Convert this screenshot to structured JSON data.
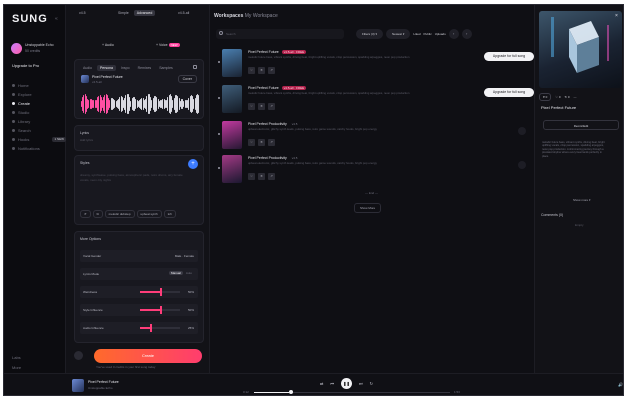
{
  "sidebar": {
    "logo": "SUNG",
    "user": {
      "name": "Unstoppable Echo",
      "credits": "50 credits"
    },
    "upgrade": "Upgrade to Pro",
    "items": [
      {
        "label": "Home",
        "active": false
      },
      {
        "label": "Explore",
        "active": false
      },
      {
        "label": "Create",
        "active": true
      },
      {
        "label": "Studio",
        "active": false
      },
      {
        "label": "Library",
        "active": false
      },
      {
        "label": "Search",
        "active": false
      },
      {
        "label": "Hooks",
        "active": false,
        "badge": "1 NEW"
      },
      {
        "label": "Notifications",
        "active": false
      }
    ],
    "bottom": [
      "Labs",
      "More"
    ]
  },
  "create": {
    "version": "v4.5",
    "mode": {
      "simple": "Simple",
      "advanced": "Advanced"
    },
    "model": "v4.5-all",
    "add_audio": "+ Audio",
    "add_voice": "+ Voice",
    "voice_badge": "NEW",
    "audio_tabs": [
      "Audio",
      "Persona",
      "Inspo",
      "Remixes",
      "Samples"
    ],
    "clip": {
      "title": "Pixel Perfect Future",
      "sub": "v4.5-all",
      "cover_btn": "Cover"
    },
    "lyrics": {
      "label": "Lyrics",
      "placeholder": "Add lyrics"
    },
    "styles": {
      "label": "Styles",
      "placeholder": "dreamy, synthwave, pulsing bass, atmospheric pads, retro drums, airy female vocals, neon city nights",
      "tags": [
        "↺",
        "⧉",
        "melodic dubstep",
        "upbeat synth",
        "lofi"
      ]
    },
    "more_options": {
      "title": "More Options",
      "rows": [
        {
          "label": "Vocal Gender",
          "value": "Male · Female"
        },
        {
          "label": "Lyrics Mode",
          "toggle": [
            "Manual",
            "Auto"
          ]
        },
        {
          "label": "Weirdness",
          "value": "50%",
          "level": 0.5
        },
        {
          "label": "Style Influence",
          "value": "50%",
          "level": 0.5
        },
        {
          "label": "Audio Influence",
          "value": "25%",
          "level": 0.25
        }
      ]
    },
    "create_button": "Create",
    "hint": "You've used 0 credits in your first song today"
  },
  "workspace": {
    "title": "Workspaces",
    "crumb": "My Workspace",
    "search_placeholder": "Search",
    "filters": [
      "Filters (3) ▾",
      "Newest ▾"
    ],
    "filter_links": [
      "Liked",
      "Public",
      "Uploads"
    ],
    "songs": [
      {
        "title": "Pixel Perfect Future",
        "tag": "v4.5-all · FREE",
        "ver": "",
        "desc": "melodic future bass, vibrant synths, driving beat, bright uplifting vocals, crisp percussion, sparkling arpeggios, neon pop production",
        "upgrade": "Upgrade for full song",
        "colors": [
          "#4a7fb0",
          "#1a2332"
        ]
      },
      {
        "title": "Pixel Perfect Future",
        "tag": "v4.5-all · FREE",
        "ver": "",
        "desc": "melodic future bass, vibrant synths, driving beat, bright uplifting vocals, crisp percussion, sparkling arpeggios, neon pop production",
        "upgrade": "Upgrade for full song",
        "colors": [
          "#3f5e7a",
          "#141a24"
        ]
      },
      {
        "title": "Pixel Perfect Productivity",
        "tag": "",
        "ver": "v4.5",
        "desc": "upbeat electronic, glitchy synth leads, pulsing bass, retro game sounds, catchy hooks, bright pop energy",
        "upgrade": "",
        "colors": [
          "#c23aa0",
          "#261833"
        ]
      },
      {
        "title": "Pixel Perfect Productivity",
        "tag": "",
        "ver": "v4.5",
        "desc": "upbeat electronic, glitchy synth leads, pulsing bass, retro game sounds, catchy hooks, bright pop energy",
        "upgrade": "",
        "colors": [
          "#a43a86",
          "#1b1830"
        ]
      }
    ],
    "end_text": "— End —",
    "show_more": "Show More"
  },
  "details": {
    "likes": "♥ 0",
    "stats": [
      "♡ 0",
      "↻ 0",
      "⋯"
    ],
    "title": "Pixel Perfect Future",
    "remix_btn": "Remix/Edit",
    "description": "melodic future bass, vibrant synths, driving beat, bright uplifting vocals, crisp percussion, sparkling arpeggios, neon pop production. A shimmering journey through a pixelated skyline where every beat lands perfectly in place.",
    "show_more": "Show more ▾",
    "comments_label": "Comments (0)",
    "comments_empty": "Empty"
  },
  "player": {
    "title": "Pixel Perfect Future",
    "artist": "Unstoppable Echo",
    "time_current": "0:12",
    "time_total": "1:53",
    "progress": 0.18
  }
}
